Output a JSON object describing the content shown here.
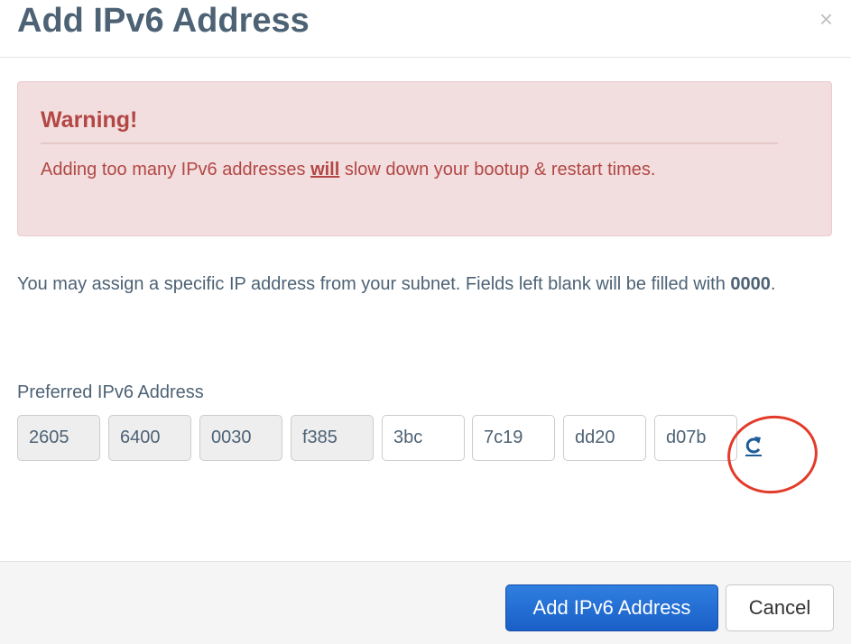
{
  "modal": {
    "title": "Add IPv6 Address",
    "close_glyph": "×"
  },
  "warning": {
    "title": "Warning!",
    "text_before": "Adding too many IPv6 addresses ",
    "text_emphasis": "will",
    "text_after": " slow down your bootup & restart times."
  },
  "info": {
    "text_before": "You may assign a specific IP address from your subnet. Fields left blank will be filled with ",
    "text_bold": "0000",
    "text_after": "."
  },
  "ip_field": {
    "label": "Preferred IPv6 Address",
    "segments": [
      {
        "value": "2605",
        "readonly": true
      },
      {
        "value": "6400",
        "readonly": true
      },
      {
        "value": "0030",
        "readonly": true
      },
      {
        "value": "f385",
        "readonly": true
      },
      {
        "value": "3bc",
        "readonly": false
      },
      {
        "value": "7c19",
        "readonly": false
      },
      {
        "value": "dd20",
        "readonly": false
      },
      {
        "value": "d07b",
        "readonly": false
      }
    ],
    "refresh_icon": "refresh-icon"
  },
  "footer": {
    "primary_label": "Add IPv6 Address",
    "cancel_label": "Cancel"
  },
  "colors": {
    "title": "#4d6275",
    "warning_text": "#b24745",
    "warning_bg": "#f2dede",
    "primary_button": "#2469d4",
    "annotation": "#e23b2a"
  }
}
